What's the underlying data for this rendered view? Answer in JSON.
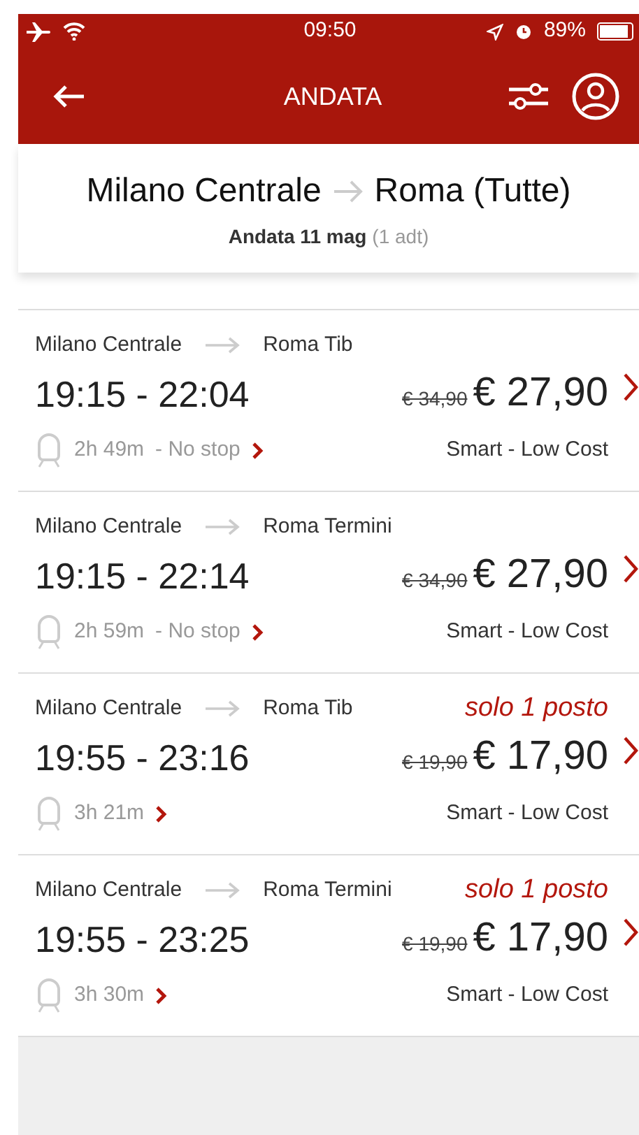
{
  "status_bar": {
    "time": "09:50",
    "battery": "89%"
  },
  "header": {
    "title": "ANDATA"
  },
  "summary": {
    "origin": "Milano Centrale",
    "destination": "Roma (Tutte)",
    "date": "Andata 11 mag",
    "passengers": "(1 adt)"
  },
  "trains": [
    {
      "from": "Milano Centrale",
      "to": "Roma Tib",
      "times": "19:15 - 22:04",
      "old_price": "€ 34,90",
      "price": "€ 27,90",
      "duration": "2h 49m",
      "stops": "- No stop",
      "fare": "Smart - Low Cost"
    },
    {
      "from": "Milano Centrale",
      "to": "Roma Termini",
      "times": "19:15 - 22:14",
      "old_price": "€ 34,90",
      "price": "€ 27,90",
      "duration": "2h 59m",
      "stops": "- No stop",
      "fare": "Smart - Low Cost"
    },
    {
      "from": "Milano Centrale",
      "to": "Roma Tib",
      "availability": "solo 1 posto",
      "times": "19:55 - 23:16",
      "old_price": "€ 19,90",
      "price": "€ 17,90",
      "duration": "3h 21m",
      "fare": "Smart - Low Cost"
    },
    {
      "from": "Milano Centrale",
      "to": "Roma Termini",
      "availability": "solo 1 posto",
      "times": "19:55 - 23:25",
      "old_price": "€ 19,90",
      "price": "€ 17,90",
      "duration": "3h 30m",
      "fare": "Smart - Low Cost"
    }
  ]
}
